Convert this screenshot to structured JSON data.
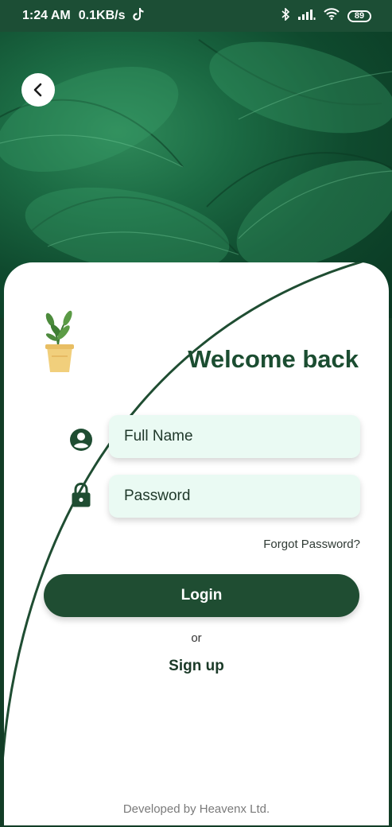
{
  "status_bar": {
    "time": "1:24 AM",
    "network_speed": "0.1KB/s",
    "battery_level": "89",
    "icons": [
      "tiktok-icon",
      "bluetooth-icon",
      "signal-icon",
      "wifi-icon",
      "battery-icon"
    ]
  },
  "header": {
    "back_icon": "chevron-left-icon"
  },
  "login": {
    "title": "Welcome back",
    "logo_icon": "potted-plant-icon",
    "fullname_placeholder": "Full Name",
    "fullname_icon": "account-circle-icon",
    "password_placeholder": "Password",
    "password_icon": "lock-icon",
    "forgot_password": "Forgot Password?",
    "login_button": "Login",
    "or_text": "or",
    "signup": "Sign up"
  },
  "footer": {
    "text": "Developed by Heavenx Ltd."
  },
  "colors": {
    "primary_green": "#1f4d32",
    "input_bg": "#eafaf3",
    "status_bar": "#1c4e35"
  }
}
